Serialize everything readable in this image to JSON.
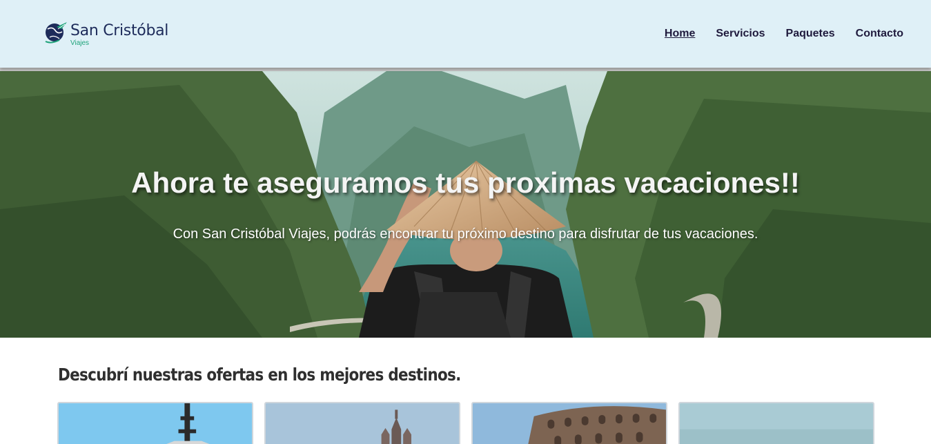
{
  "brand": {
    "name_part1": "San ",
    "name_part2": "Cristóbal",
    "subtitle": "Viajes",
    "logo_icon": "globe-plane-icon",
    "colors": {
      "primary": "#1d2b5a",
      "accent": "#1fa37a"
    }
  },
  "nav": {
    "items": [
      {
        "label": "Home",
        "active": true
      },
      {
        "label": "Servicios",
        "active": false
      },
      {
        "label": "Paquetes",
        "active": false
      },
      {
        "label": "Contacto",
        "active": false
      }
    ]
  },
  "hero": {
    "title": "Ahora te aseguramos tus proximas vacaciones!!",
    "subtitle": "Con San Cristóbal Viajes, podrás encontrar tu próximo destino para disfrutar de tus vacaciones.",
    "image": "traveler-with-conical-hat-in-valley"
  },
  "offers": {
    "title": "Descubrí nuestras ofertas en los mejores destinos.",
    "cards": [
      {
        "image": "tower-blue-sky"
      },
      {
        "image": "gothic-cathedral"
      },
      {
        "image": "colosseum"
      },
      {
        "image": "misty-landscape"
      }
    ]
  }
}
